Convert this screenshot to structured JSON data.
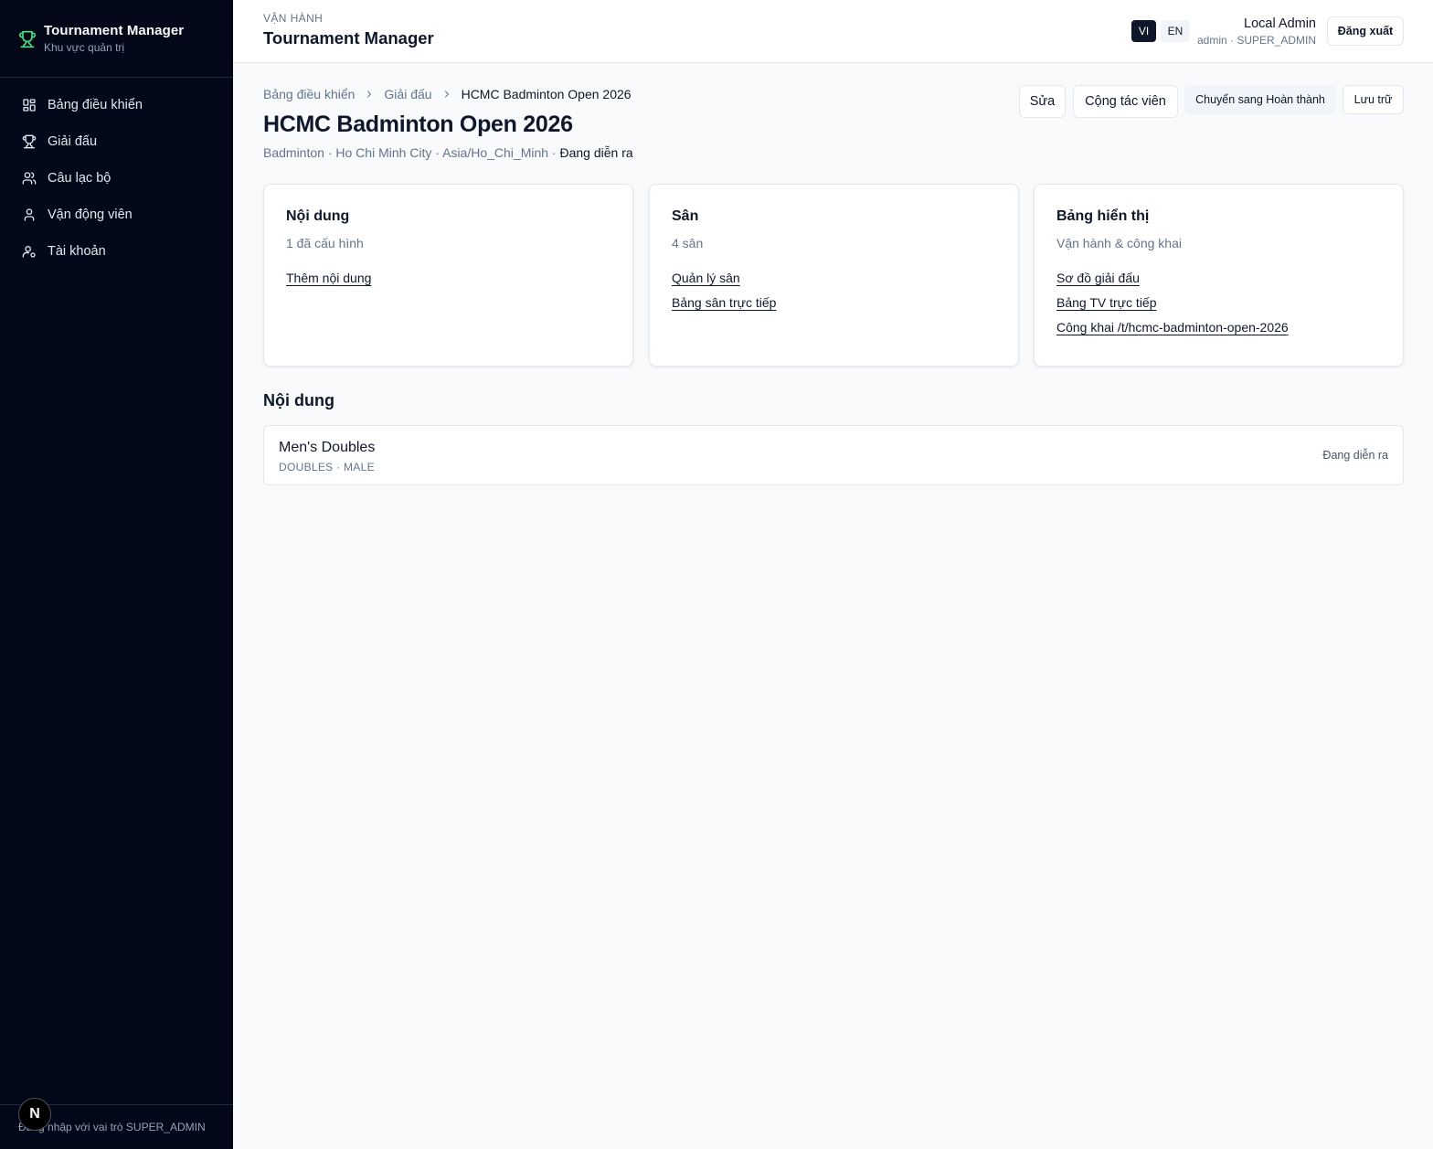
{
  "sidebar": {
    "brand_title": "Tournament Manager",
    "brand_subtitle": "Khu vực quản trị",
    "items": [
      {
        "label": "Bảng điều khiển",
        "icon": "dashboard-icon"
      },
      {
        "label": "Giải đấu",
        "icon": "trophy-icon"
      },
      {
        "label": "Câu lạc bộ",
        "icon": "users-icon"
      },
      {
        "label": "Vận động viên",
        "icon": "user-icon"
      },
      {
        "label": "Tài khoản",
        "icon": "user-cog-icon"
      }
    ],
    "footer": "Đăng nhập với vai trò SUPER_ADMIN",
    "accent": "#4ade80"
  },
  "topbar": {
    "overline": "VẬN HÀNH",
    "title": "Tournament Manager",
    "lang_vi": "VI",
    "lang_en": "EN",
    "user_name": "Local Admin",
    "user_role": "admin · SUPER_ADMIN",
    "logout": "Đăng xuất"
  },
  "breadcrumb": {
    "home": "Bảng điều khiển",
    "section": "Giải đấu",
    "current": "HCMC Badminton Open 2026"
  },
  "page": {
    "title": "HCMC Badminton Open 2026",
    "meta_sport": "Badminton",
    "meta_city": "Ho Chi Minh City",
    "meta_tz": "Asia/Ho_Chi_Minh",
    "meta_status": "Đang diễn ra",
    "sep": " · "
  },
  "actions": {
    "edit": "Sửa",
    "collaborators": "Cộng tác viên",
    "complete": "Chuyển sang Hoàn thành",
    "archive": "Lưu trữ"
  },
  "cards": {
    "events": {
      "title": "Nội dung",
      "subtitle": "1 đã cấu hình",
      "links": [
        "Thêm nội dung"
      ]
    },
    "courts": {
      "title": "Sân",
      "subtitle": "4 sân",
      "links": [
        "Quản lý sân",
        "Bảng sân trực tiếp"
      ]
    },
    "displays": {
      "title": "Bảng hiển thị",
      "subtitle": "Vận hành & công khai",
      "links": [
        "Sơ đồ giải đấu",
        "Bảng TV trực tiếp",
        "Công khai /t/hcmc-badminton-open-2026"
      ]
    }
  },
  "events_section": {
    "title": "Nội dung",
    "rows": [
      {
        "name": "Men's Doubles",
        "type": "DOUBLES · MALE",
        "status": "Đang diễn ra"
      }
    ]
  },
  "next_badge": "N"
}
